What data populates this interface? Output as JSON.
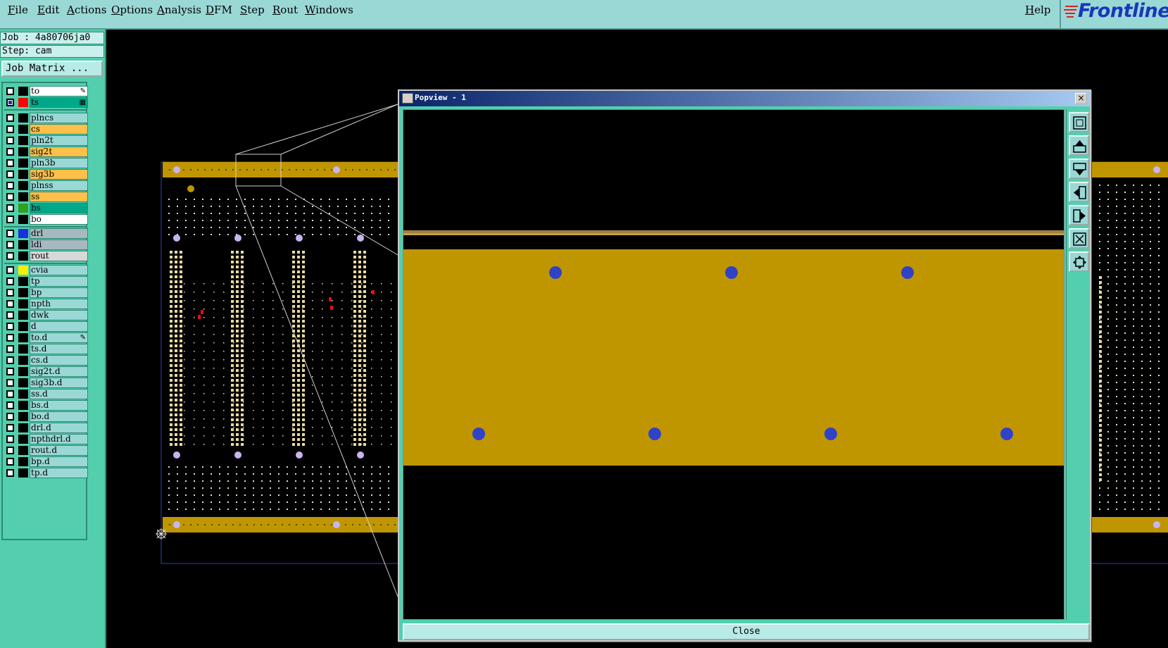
{
  "menu": {
    "items": [
      "File",
      "Edit",
      "Actions",
      "Options",
      "Analysis",
      "DFM",
      "Step",
      "Rout",
      "Windows"
    ],
    "help": "Help",
    "logo": "Frontline"
  },
  "info": {
    "job": "Job : 4a80706ja0",
    "step": "Step: cam",
    "job_matrix": "Job Matrix ..."
  },
  "layers": [
    {
      "name": "to",
      "color": "#000000",
      "bg": "#ffffff",
      "checked": false,
      "mark": "pen"
    },
    {
      "name": "ts",
      "color": "#ff0000",
      "bg": "#00a88a",
      "checked": true,
      "mark": "grid"
    },
    {
      "name": "plncs",
      "color": "#000000",
      "bg": "#9ad8d6",
      "checked": false
    },
    {
      "name": "cs",
      "color": "#000000",
      "bg": "#ffc04a",
      "checked": false
    },
    {
      "name": "pln2t",
      "color": "#000000",
      "bg": "#9ad8d6",
      "checked": false
    },
    {
      "name": "sig2t",
      "color": "#000000",
      "bg": "#ffc04a",
      "checked": false
    },
    {
      "name": "pln3b",
      "color": "#000000",
      "bg": "#9ad8d6",
      "checked": false
    },
    {
      "name": "sig3b",
      "color": "#000000",
      "bg": "#ffc04a",
      "checked": false
    },
    {
      "name": "plnss",
      "color": "#000000",
      "bg": "#9ad8d6",
      "checked": false
    },
    {
      "name": "ss",
      "color": "#000000",
      "bg": "#ffc04a",
      "checked": false
    },
    {
      "name": "bs",
      "color": "#2fa020",
      "bg": "#00a88a",
      "checked": false
    },
    {
      "name": "bo",
      "color": "#000000",
      "bg": "#ffffff",
      "checked": false
    },
    {
      "name": "drl",
      "color": "#1a2fe0",
      "bg": "#a8b8c0",
      "checked": false
    },
    {
      "name": "ldi",
      "color": "#000000",
      "bg": "#a8b8c0",
      "checked": false
    },
    {
      "name": "rout",
      "color": "#000000",
      "bg": "#d8d8d8",
      "checked": false
    },
    {
      "name": "cvia",
      "color": "#f8f000",
      "bg": "#9ad8d6",
      "checked": false
    },
    {
      "name": "tp",
      "color": "#000000",
      "bg": "#9ad8d6",
      "checked": false
    },
    {
      "name": "bp",
      "color": "#000000",
      "bg": "#9ad8d6",
      "checked": false
    },
    {
      "name": "npth",
      "color": "#000000",
      "bg": "#9ad8d6",
      "checked": false
    },
    {
      "name": "dwk",
      "color": "#000000",
      "bg": "#9ad8d6",
      "checked": false
    },
    {
      "name": "d",
      "color": "#000000",
      "bg": "#9ad8d6",
      "checked": false
    },
    {
      "name": "to.d",
      "color": "#000000",
      "bg": "#9ad8d6",
      "checked": false,
      "mark": "pen"
    },
    {
      "name": "ts.d",
      "color": "#000000",
      "bg": "#9ad8d6",
      "checked": false
    },
    {
      "name": "cs.d",
      "color": "#000000",
      "bg": "#9ad8d6",
      "checked": false
    },
    {
      "name": "sig2t.d",
      "color": "#000000",
      "bg": "#9ad8d6",
      "checked": false
    },
    {
      "name": "sig3b.d",
      "color": "#000000",
      "bg": "#9ad8d6",
      "checked": false
    },
    {
      "name": "ss.d",
      "color": "#000000",
      "bg": "#9ad8d6",
      "checked": false
    },
    {
      "name": "bs.d",
      "color": "#000000",
      "bg": "#9ad8d6",
      "checked": false
    },
    {
      "name": "bo.d",
      "color": "#000000",
      "bg": "#9ad8d6",
      "checked": false
    },
    {
      "name": "drl.d",
      "color": "#000000",
      "bg": "#9ad8d6",
      "checked": false
    },
    {
      "name": "npthdrl.d",
      "color": "#000000",
      "bg": "#9ad8d6",
      "checked": false
    },
    {
      "name": "rout.d",
      "color": "#000000",
      "bg": "#9ad8d6",
      "checked": false
    },
    {
      "name": "bp.d",
      "color": "#000000",
      "bg": "#9ad8d6",
      "checked": false
    },
    {
      "name": "tp.d",
      "color": "#000000",
      "bg": "#9ad8d6",
      "checked": false
    }
  ],
  "popview": {
    "title": "Popview - 1",
    "close_x": "×",
    "close_button": "Close",
    "tools": [
      "zoom-window-icon",
      "pan-up-icon",
      "pan-down-icon",
      "pan-left-icon",
      "pan-right-icon",
      "zoom-home-icon",
      "zoom-fit-icon"
    ]
  },
  "colors": {
    "panel": "#53cfae",
    "menubar": "#9ad8d6",
    "copper": "#bf9600",
    "pad": "#3042c8",
    "via": "#c8b4f0",
    "dots": "#e8d8a0",
    "accent": "#1a36b8"
  }
}
